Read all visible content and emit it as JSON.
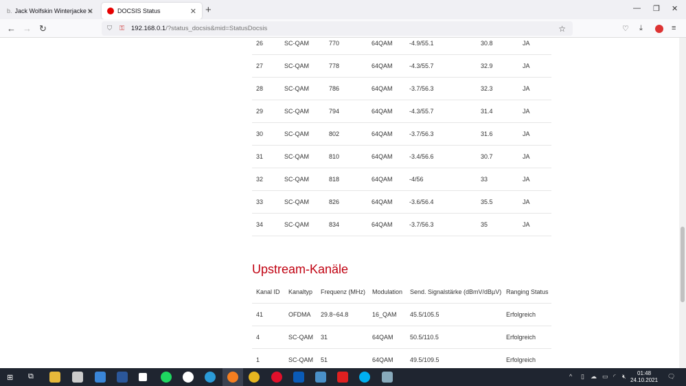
{
  "browser": {
    "tabs": [
      {
        "label": "Jack Wolfskin Winterjacke »OST",
        "active": false
      },
      {
        "label": "DOCSIS Status",
        "active": true
      }
    ],
    "url_host": "192.168.0.1",
    "url_path": "/?status_docsis&mid=StatusDocsis"
  },
  "downstream_rows": [
    [
      "26",
      "SC-QAM",
      "770",
      "64QAM",
      "-4.9/55.1",
      "30.8",
      "JA"
    ],
    [
      "27",
      "SC-QAM",
      "778",
      "64QAM",
      "-4.3/55.7",
      "32.9",
      "JA"
    ],
    [
      "28",
      "SC-QAM",
      "786",
      "64QAM",
      "-3.7/56.3",
      "32.3",
      "JA"
    ],
    [
      "29",
      "SC-QAM",
      "794",
      "64QAM",
      "-4.3/55.7",
      "31.4",
      "JA"
    ],
    [
      "30",
      "SC-QAM",
      "802",
      "64QAM",
      "-3.7/56.3",
      "31.6",
      "JA"
    ],
    [
      "31",
      "SC-QAM",
      "810",
      "64QAM",
      "-3.4/56.6",
      "30.7",
      "JA"
    ],
    [
      "32",
      "SC-QAM",
      "818",
      "64QAM",
      "-4/56",
      "33",
      "JA"
    ],
    [
      "33",
      "SC-QAM",
      "826",
      "64QAM",
      "-3.6/56.4",
      "35.5",
      "JA"
    ],
    [
      "34",
      "SC-QAM",
      "834",
      "64QAM",
      "-3.7/56.3",
      "35",
      "JA"
    ]
  ],
  "upstream": {
    "title": "Upstream-Kanäle",
    "headers": [
      "Kanal ID",
      "Kanaltyp",
      "Frequenz (MHz)",
      "Modulation",
      "Send. Signalstärke (dBmV/dBµV)",
      "Ranging Status"
    ],
    "rows": [
      [
        "41",
        "OFDMA",
        "29.8~64.8",
        "16_QAM",
        "45.5/105.5",
        "Erfolgreich"
      ],
      [
        "4",
        "SC-QAM",
        "31",
        "64QAM",
        "50.5/110.5",
        "Erfolgreich"
      ],
      [
        "1",
        "SC-QAM",
        "51",
        "64QAM",
        "49.5/109.5",
        "Erfolgreich"
      ]
    ]
  },
  "taskbar": {
    "time": "01:48",
    "date": "24.10.2021"
  },
  "colors": {
    "accent": "#c00010"
  }
}
